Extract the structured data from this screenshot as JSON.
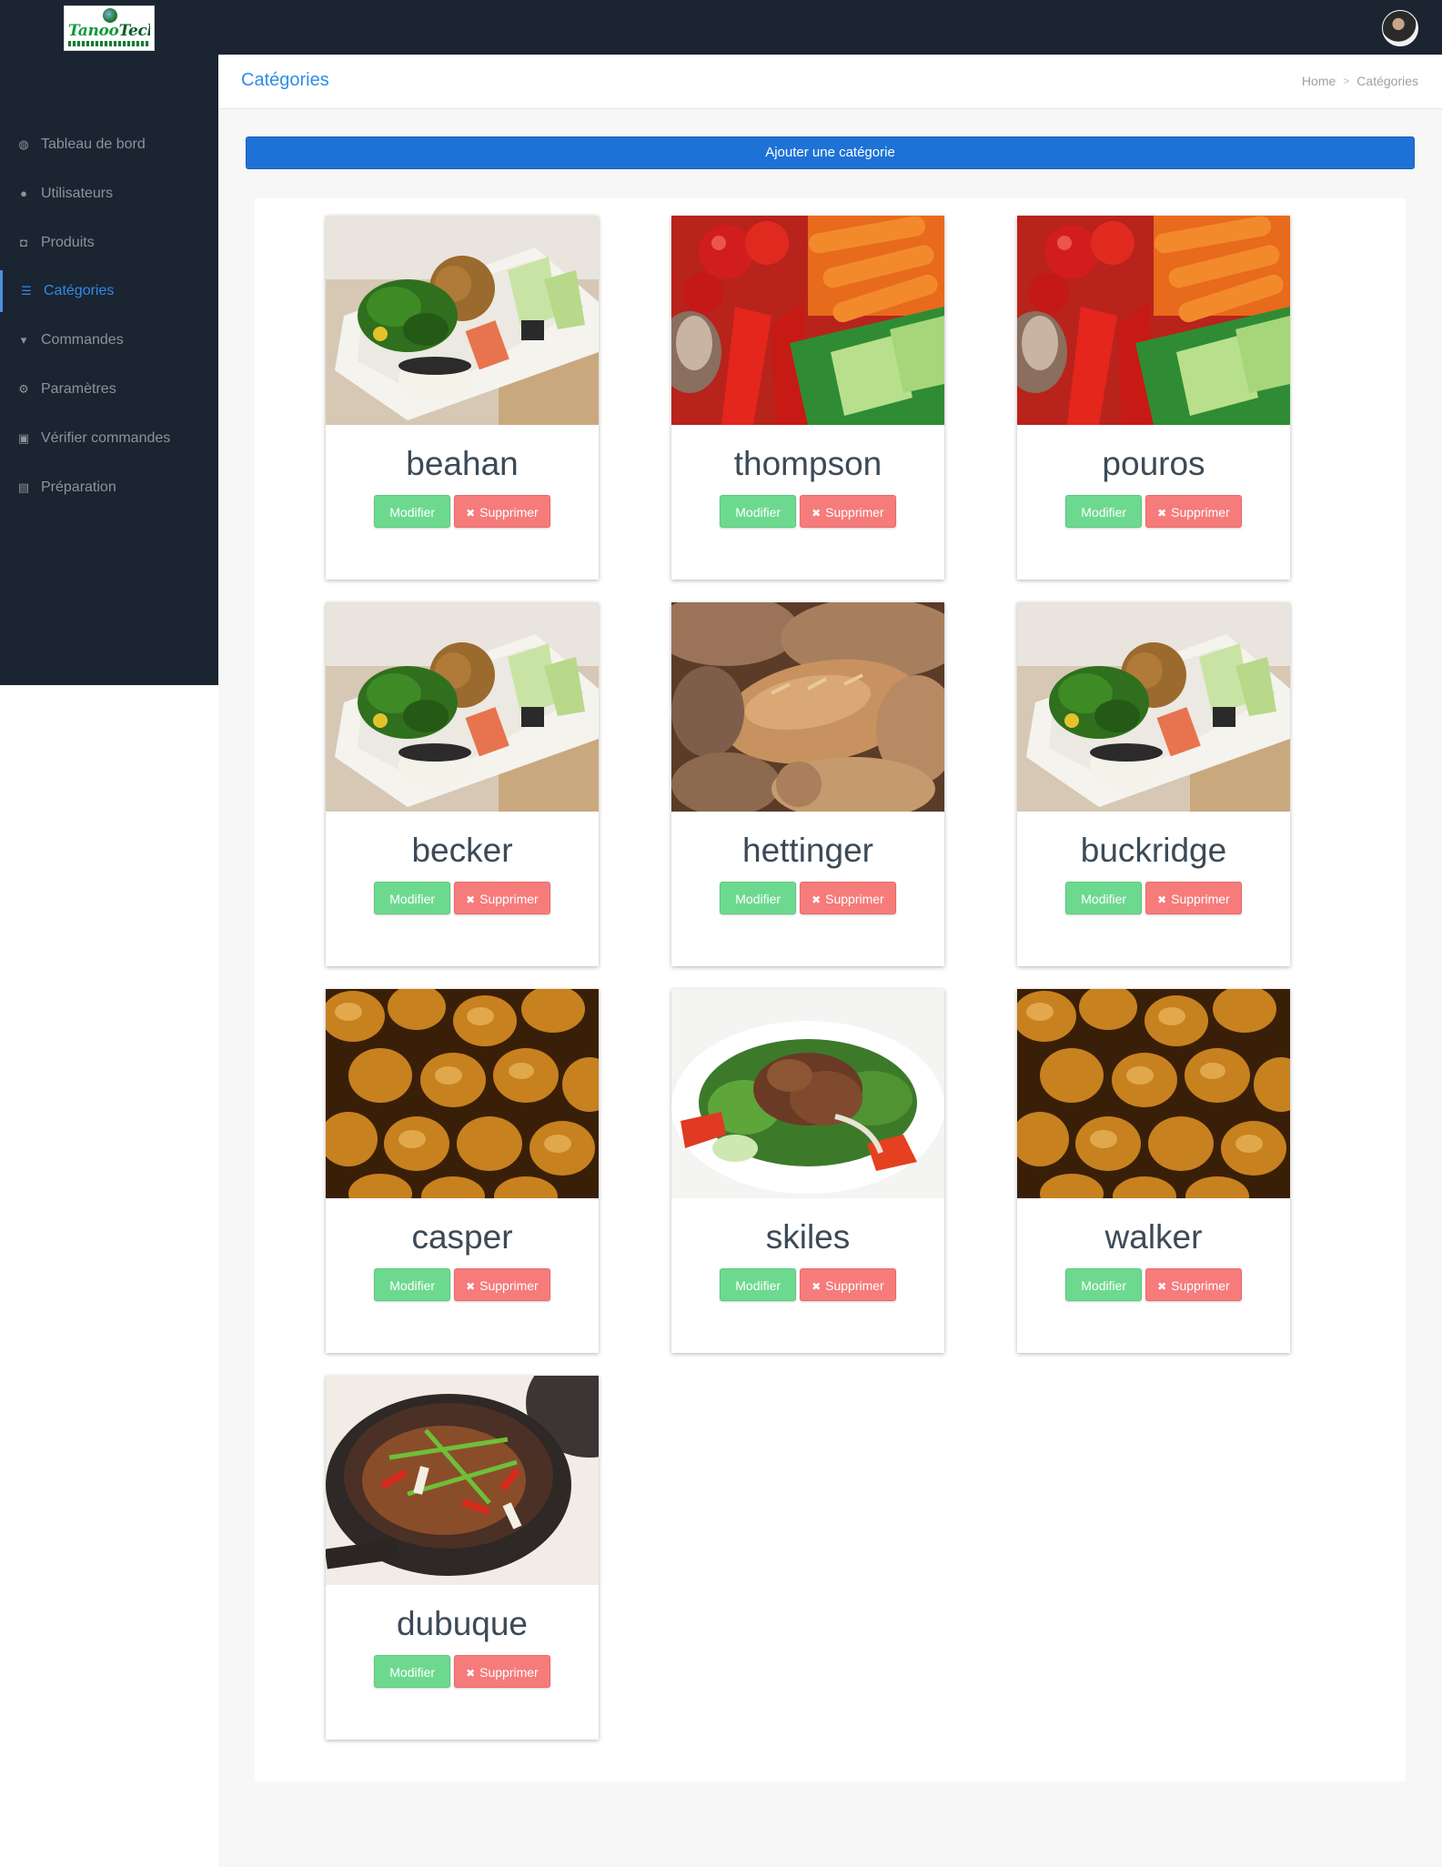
{
  "brand": {
    "logo_text_a": "Tanoo",
    "logo_text_b": "Tech"
  },
  "header": {
    "page_title": "Catégories",
    "breadcrumb_home": "Home",
    "breadcrumb_current": "Catégories"
  },
  "sidebar": {
    "items": [
      {
        "label": "Tableau de bord",
        "icon": "dashboard-icon",
        "glyph": "◍"
      },
      {
        "label": "Utilisateurs",
        "icon": "user-icon",
        "glyph": "●"
      },
      {
        "label": "Produits",
        "icon": "shopping-bag-icon",
        "glyph": "◘"
      },
      {
        "label": "Catégories",
        "icon": "list-icon",
        "glyph": "☰",
        "active": true
      },
      {
        "label": "Commandes",
        "icon": "cart-icon",
        "glyph": "▾"
      },
      {
        "label": "Paramètres",
        "icon": "gear-icon",
        "glyph": "⚙"
      },
      {
        "label": "Vérifier commandes",
        "icon": "calendar-check-icon",
        "glyph": "▣"
      },
      {
        "label": "Préparation",
        "icon": "archive-icon",
        "glyph": "▤"
      }
    ]
  },
  "actions": {
    "add_category": "Ajouter une catégorie"
  },
  "card_buttons": {
    "edit": "Modifier",
    "delete": "Supprimer",
    "delete_icon": "close-icon"
  },
  "categories": [
    {
      "name": "beahan",
      "image": "sushi-tray"
    },
    {
      "name": "thompson",
      "image": "vegetables"
    },
    {
      "name": "pouros",
      "image": "vegetables"
    },
    {
      "name": "becker",
      "image": "sushi-tray"
    },
    {
      "name": "hettinger",
      "image": "bread-loaves"
    },
    {
      "name": "buckridge",
      "image": "sushi-tray"
    },
    {
      "name": "casper",
      "image": "bread-rolls"
    },
    {
      "name": "skiles",
      "image": "beef-salad"
    },
    {
      "name": "walker",
      "image": "bread-rolls"
    },
    {
      "name": "dubuque",
      "image": "clay-pot-stew"
    }
  ]
}
